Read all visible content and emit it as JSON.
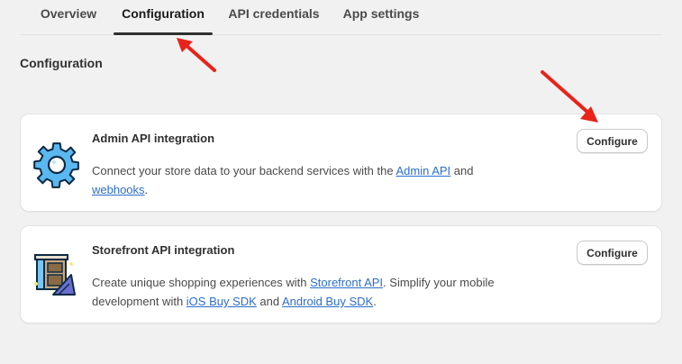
{
  "tabs": [
    {
      "label": "Overview"
    },
    {
      "label": "Configuration",
      "active": true
    },
    {
      "label": "API credentials"
    },
    {
      "label": "App settings"
    }
  ],
  "section_title": "Configuration",
  "cards": [
    {
      "title": "Admin API integration",
      "desc_pre": "Connect your store data to your backend services with the ",
      "link1": "Admin API",
      "desc_mid": " and",
      "link2": "webhooks",
      "desc_post": ".",
      "button": "Configure",
      "icon": "gear-icon"
    },
    {
      "title": "Storefront API integration",
      "desc_pre": "Create unique shopping experiences with ",
      "link1": "Storefront API",
      "desc_mid": ". Simplify your mobile development with ",
      "link2": "iOS Buy SDK",
      "desc_and": " and ",
      "link3": "Android Buy SDK",
      "desc_post": ".",
      "button": "Configure",
      "icon": "storefront-icon"
    }
  ],
  "colors": {
    "background": "#f1f1f1",
    "link": "#2c6ecb",
    "annotation_arrow": "#e8231a",
    "gear_fill": "#5ab8f0"
  }
}
